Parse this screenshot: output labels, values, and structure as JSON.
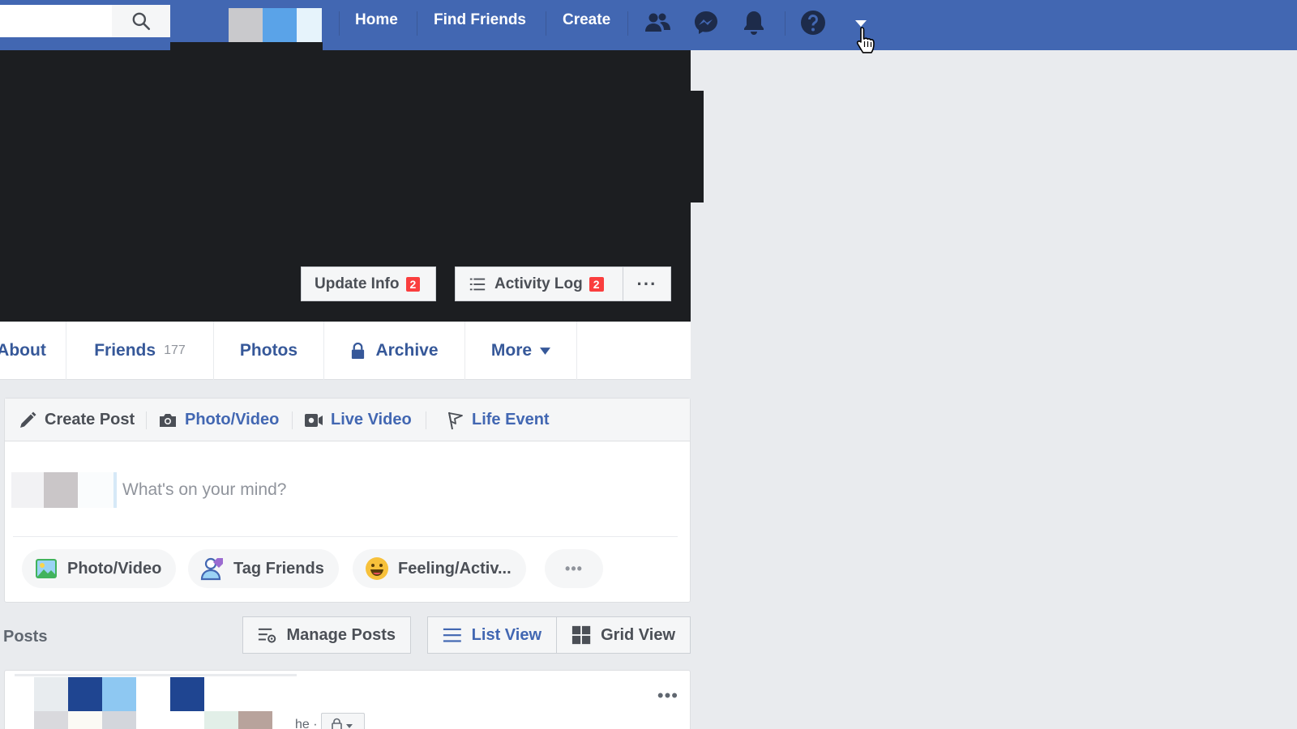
{
  "topbar": {
    "nav": [
      "Home",
      "Find Friends",
      "Create"
    ],
    "icons": [
      "friends-icon",
      "messenger-icon",
      "notifications-icon",
      "help-icon",
      "account-menu-caret-icon"
    ]
  },
  "cover": {
    "update_info": "Update Info",
    "update_info_badge": "2",
    "activity_log": "Activity Log",
    "activity_log_badge": "2",
    "more_dots": "···"
  },
  "timeline_nav": {
    "about": "About",
    "friends": "Friends",
    "friends_count": "177",
    "photos": "Photos",
    "archive": "Archive",
    "more": "More"
  },
  "composer": {
    "tabs": [
      "Create Post",
      "Photo/Video",
      "Live Video",
      "Life Event"
    ],
    "placeholder": "What's on your mind?",
    "actions": [
      "Photo/Video",
      "Tag Friends",
      "Feeling/Activ..."
    ],
    "more_dots": "•••"
  },
  "posts_bar": {
    "label": "Posts",
    "manage_posts": "Manage Posts",
    "list_view": "List View",
    "grid_view": "Grid View"
  },
  "post": {
    "menu_dots": "•••",
    "snippet": "he ·"
  },
  "colors": {
    "brand": "#4267b2",
    "link": "#365899",
    "badge": "#fa3e3e",
    "background": "#e9ebee"
  }
}
